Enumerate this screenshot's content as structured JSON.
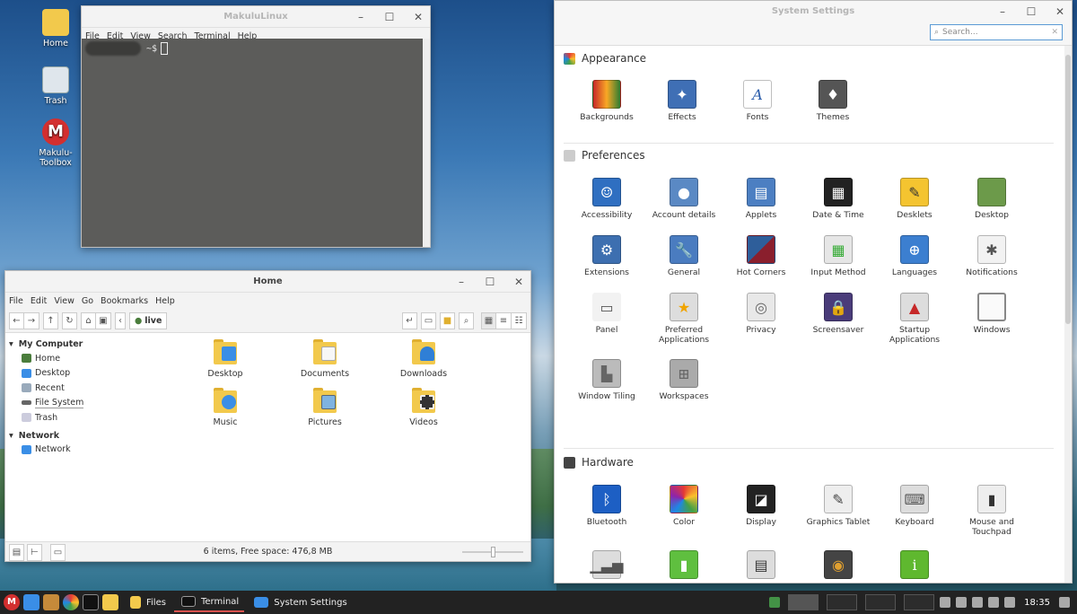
{
  "desktop": {
    "icons": [
      {
        "label": "Home"
      },
      {
        "label": "Trash"
      },
      {
        "label": "Makulu-Toolbox"
      }
    ]
  },
  "terminal": {
    "title": "MakuluLinux",
    "menu": [
      "File",
      "Edit",
      "View",
      "Search",
      "Terminal",
      "Help"
    ],
    "prompt": "~$"
  },
  "files": {
    "title": "Home",
    "menu": [
      "File",
      "Edit",
      "View",
      "Go",
      "Bookmarks",
      "Help"
    ],
    "path": "live",
    "sidebar": {
      "my_computer": "My Computer",
      "items": [
        "Home",
        "Desktop",
        "Recent",
        "File System",
        "Trash"
      ],
      "network": "Network",
      "network_items": [
        "Network"
      ]
    },
    "folders": [
      "Desktop",
      "Documents",
      "Downloads",
      "Music",
      "Pictures",
      "Videos"
    ],
    "status": "6 items, Free space: 476,8 MB"
  },
  "settings": {
    "title": "System Settings",
    "search_placeholder": "Search...",
    "sections": {
      "appearance": {
        "title": "Appearance",
        "items": [
          "Backgrounds",
          "Effects",
          "Fonts",
          "Themes"
        ]
      },
      "preferences": {
        "title": "Preferences",
        "items": [
          "Accessibility",
          "Account details",
          "Applets",
          "Date & Time",
          "Desklets",
          "Desktop",
          "Extensions",
          "General",
          "Hot Corners",
          "Input Method",
          "Languages",
          "Notifications",
          "Panel",
          "Preferred Applications",
          "Privacy",
          "Screensaver",
          "Startup Applications",
          "Windows",
          "Window Tiling",
          "Workspaces"
        ]
      },
      "hardware": {
        "title": "Hardware",
        "items": [
          "Bluetooth",
          "Color",
          "Display",
          "Graphics Tablet",
          "Keyboard",
          "Mouse and Touchpad"
        ]
      }
    }
  },
  "taskbar": {
    "tasks": [
      "Files",
      "Terminal",
      "System Settings"
    ],
    "clock": "18:35"
  }
}
